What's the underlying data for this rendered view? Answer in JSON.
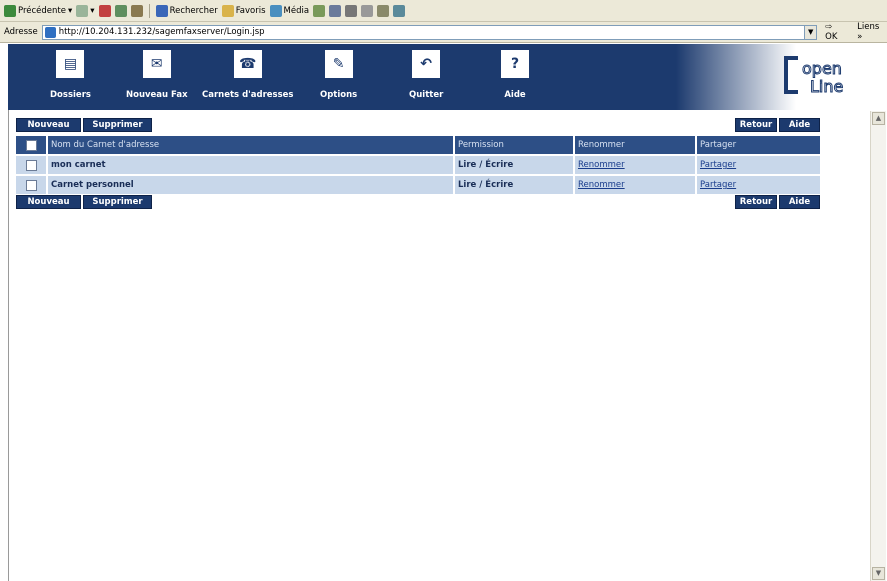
{
  "browser": {
    "toolbar": {
      "back": "Précédente",
      "search": "Rechercher",
      "favorites": "Favoris",
      "media": "Média"
    },
    "address_label": "Adresse",
    "url": "http://10.204.131.232/sagemfaxserver/Login.jsp",
    "ok": "OK",
    "links": "Liens"
  },
  "nav": {
    "items": [
      {
        "label": "Dossiers",
        "icon": "folder-icon"
      },
      {
        "label": "Nouveau Fax",
        "icon": "fax-icon"
      },
      {
        "label": "Carnets d'adresses",
        "icon": "phone-icon"
      },
      {
        "label": "Options",
        "icon": "wrench-icon"
      },
      {
        "label": "Quitter",
        "icon": "exit-icon"
      },
      {
        "label": "Aide",
        "icon": "help-icon"
      }
    ]
  },
  "logo": {
    "text1": "open",
    "text2": "Line"
  },
  "actions": {
    "new": "Nouveau",
    "delete": "Supprimer",
    "back": "Retour",
    "help": "Aide"
  },
  "table": {
    "headers": [
      "Nom du Carnet d'adresse",
      "Permission",
      "Renommer",
      "Partager"
    ],
    "rows": [
      {
        "name": "mon carnet",
        "permission": "Lire / Écrire",
        "rename": "Renommer",
        "share": "Partager"
      },
      {
        "name": "Carnet personnel",
        "permission": "Lire / Écrire",
        "rename": "Renommer",
        "share": "Partager"
      }
    ]
  },
  "colors": {
    "header_bg": "#1c3a6e",
    "table_header": "#2d4f86",
    "table_row": "#c8d7ea"
  }
}
